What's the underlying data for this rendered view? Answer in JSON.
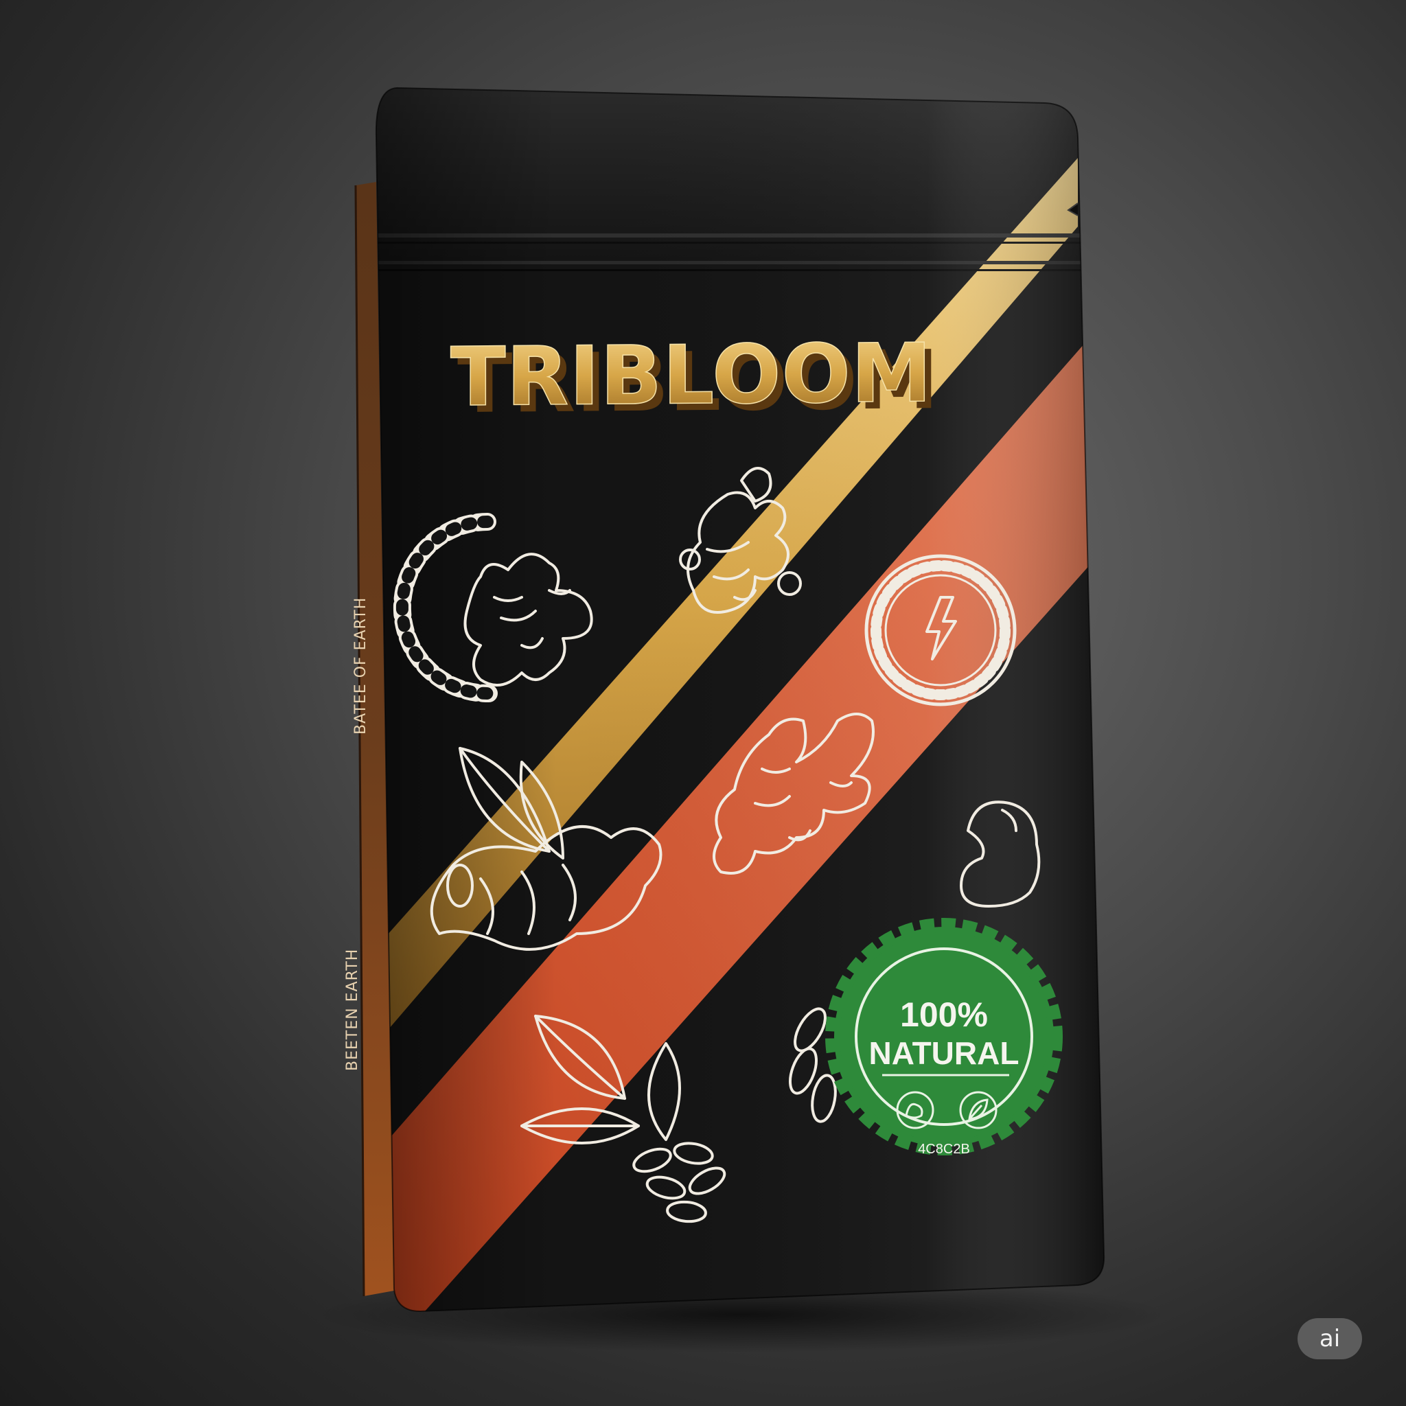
{
  "product": {
    "brand": "TRIBLOOM",
    "gusset_text_top": "BATEE OF EARTH",
    "gusset_text_bottom": "BEETEN EARTH"
  },
  "seal": {
    "headline": "100%",
    "subline": "NATURAL",
    "code": "4C8C2B",
    "icons": [
      "muscle-icon",
      "leaf-icon"
    ]
  },
  "badge": {
    "label": "ai"
  },
  "colors": {
    "pouch": "#141414",
    "gold_stripe": "#c9a455",
    "orange_stripe": "#d4562a",
    "seal_green": "#2e8a3a",
    "brand_gold": "#d8a84a"
  },
  "icons": [
    "greek-key-ring-icon",
    "ginger-root-icon",
    "lightning-bolt-icon",
    "leaf-icon",
    "muscle-arm-icon",
    "seeds-icon"
  ]
}
